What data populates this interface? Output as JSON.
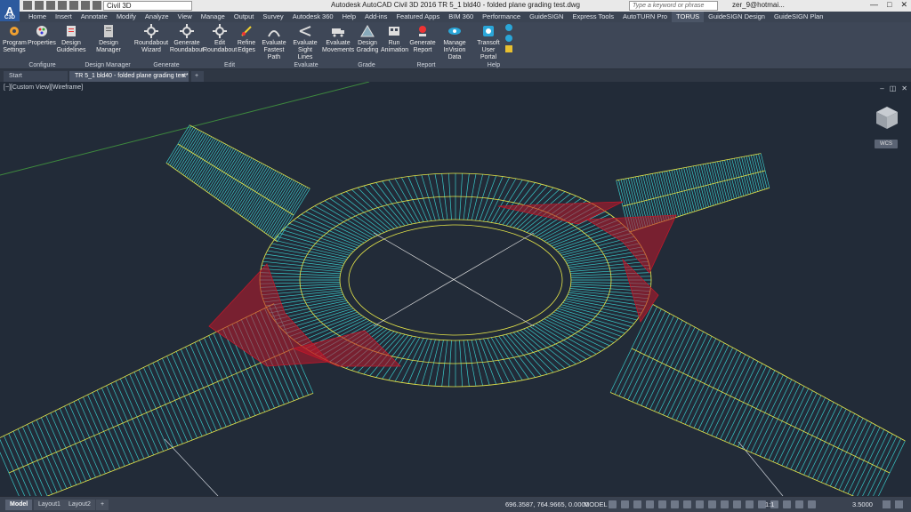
{
  "app": {
    "logo_letter": "A",
    "logo_sub": "C3D",
    "workspace": "Civil 3D",
    "window_title": "Autodesk AutoCAD Civil 3D 2016    TR 5_1 bld40 - folded plane grading test.dwg",
    "search_placeholder": "Type a keyword or phrase",
    "user": "zer_9@hotmai...",
    "minimize": "—",
    "restore": "□",
    "close": "✕"
  },
  "menu_tabs": [
    "Home",
    "Insert",
    "Annotate",
    "Modify",
    "Analyze",
    "View",
    "Manage",
    "Output",
    "Survey",
    "Autodesk 360",
    "Help",
    "Add-ins",
    "Featured Apps",
    "BIM 360",
    "Performance",
    "GuideSIGN",
    "Express Tools",
    "AutoTURN Pro",
    "TORUS",
    "GuideSIGN Design",
    "GuideSIGN Plan"
  ],
  "active_tab": "TORUS",
  "ribbon": {
    "panels": [
      {
        "label": "Configure",
        "buttons": [
          "Program Settings",
          "Properties",
          "Design Guidelines"
        ]
      },
      {
        "label": "Design Manager",
        "buttons": [
          "Design Manager"
        ]
      },
      {
        "label": "Generate",
        "buttons": [
          "Roundabout Wizard",
          "Generate Roundabout"
        ]
      },
      {
        "label": "Edit",
        "buttons": [
          "Edit Roundabout",
          "Refine Edges"
        ]
      },
      {
        "label": "Evaluate",
        "buttons": [
          "Evaluate Fastest Path",
          "Evaluate Sight Lines",
          "Evaluate Movements"
        ]
      },
      {
        "label": "Grade",
        "buttons": [
          "Design Grading"
        ]
      },
      {
        "label": "Report",
        "buttons": [
          "Run Animation",
          "Generate Report",
          "Manage InVision Data"
        ]
      },
      {
        "label": "Help",
        "buttons": [
          "Transoft User Portal"
        ]
      }
    ]
  },
  "doc_tabs": {
    "start": "Start",
    "drawing": "TR 5_1 bld40 - folded plane grading test*",
    "close": "×",
    "add": "+"
  },
  "viewport": {
    "label": "[−][Custom View][Wireframe]",
    "wcs": "WCS"
  },
  "status": {
    "layouts": [
      "Model",
      "Layout1",
      "Layout2"
    ],
    "add": "+",
    "coords": "696.3587, 764.9665, 0.0000",
    "space": "MODEL",
    "annotation_scale": "1:1",
    "value": "3.5000"
  },
  "colors": {
    "ribbon_bg": "#3e4757",
    "viewport_bg": "#222b38",
    "grading_lines": "#39c8c8",
    "red_zones": "#c0182a",
    "yellow_lines": "#e8e84a"
  }
}
